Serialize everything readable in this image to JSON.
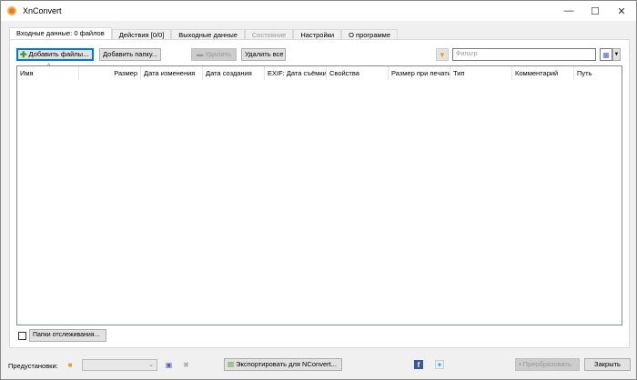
{
  "window": {
    "title": "XnConvert",
    "minimize": "—",
    "maximize": "☐",
    "close": "✕"
  },
  "tabs": [
    {
      "label": "Входные данные: 0 файлов"
    },
    {
      "label": "Действия [0/0]"
    },
    {
      "label": "Выходные данные"
    },
    {
      "label": "Состояние"
    },
    {
      "label": "Настройки"
    },
    {
      "label": "О программе"
    }
  ],
  "toolbar": {
    "add_files": "Добавить файлы...",
    "add_folder": "Добавить папку...",
    "remove": "Удалить",
    "remove_all": "Удалить все",
    "filter_placeholder": "Фильтр"
  },
  "columns": [
    "Имя",
    "Размер",
    "Дата изменения",
    "Дата создания",
    "EXIF: Дата съёмки",
    "Свойства",
    "Размер при печати",
    "Тип",
    "Комментарий",
    "Путь"
  ],
  "watch": {
    "label": "Папки отслеживания..."
  },
  "bottom": {
    "presets_label": "Предустановки:",
    "export": "Экспортировать для NConvert...",
    "convert": "Преобразовать",
    "close": "Закрыть"
  }
}
